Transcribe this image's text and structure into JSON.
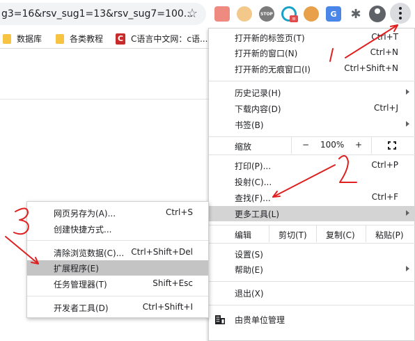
{
  "omnibox": {
    "url_text": "g3=16&rsv_sug1=13&rsv_sug7=100..."
  },
  "toolbar": {
    "stop_ext_label": "STOP",
    "translate_ext_label": "G",
    "badge_label": "≡"
  },
  "bookmarks": [
    {
      "label": "数据库",
      "icon": "folder-icon"
    },
    {
      "label": "各类教程",
      "icon": "folder-icon"
    },
    {
      "label": "C语言中文网：c语...",
      "icon": "c-logo-icon",
      "logo_letter": "C"
    }
  ],
  "menu": {
    "new_tab": {
      "label": "打开新的标签页(T)",
      "shortcut": "Ctrl+T"
    },
    "new_window": {
      "label": "打开新的窗口(N)",
      "shortcut": "Ctrl+N"
    },
    "incognito": {
      "label": "打开新的无痕窗口(I)",
      "shortcut": "Ctrl+Shift+N"
    },
    "history": {
      "label": "历史记录(H)"
    },
    "downloads": {
      "label": "下载内容(D)",
      "shortcut": "Ctrl+J"
    },
    "bookmarks": {
      "label": "书签(B)"
    },
    "zoom": {
      "label": "缩放",
      "minus": "−",
      "value": "100%",
      "plus": "+"
    },
    "print": {
      "label": "打印(P)...",
      "shortcut": "Ctrl+P"
    },
    "cast": {
      "label": "投射(C)..."
    },
    "find": {
      "label": "查找(F)...",
      "shortcut": "Ctrl+F"
    },
    "more_tools": {
      "label": "更多工具(L)"
    },
    "edit": {
      "label": "编辑",
      "cut": "剪切(T)",
      "copy": "复制(C)",
      "paste": "粘贴(P)"
    },
    "settings": {
      "label": "设置(S)"
    },
    "help": {
      "label": "帮助(E)"
    },
    "exit": {
      "label": "退出(X)"
    },
    "managed": {
      "label": "由贵单位管理"
    }
  },
  "submenu": {
    "save_page": {
      "label": "网页另存为(A)...",
      "shortcut": "Ctrl+S"
    },
    "create_shortcut": {
      "label": "创建快捷方式..."
    },
    "clear_data": {
      "label": "清除浏览数据(C)...",
      "shortcut": "Ctrl+Shift+Del"
    },
    "extensions": {
      "label": "扩展程序(E)"
    },
    "task_manager": {
      "label": "任务管理器(T)",
      "shortcut": "Shift+Esc"
    },
    "dev_tools": {
      "label": "开发者工具(D)",
      "shortcut": "Ctrl+Shift+I"
    }
  },
  "colors": {
    "highlight": "#d4d4d4",
    "annotation": "#e02020"
  }
}
